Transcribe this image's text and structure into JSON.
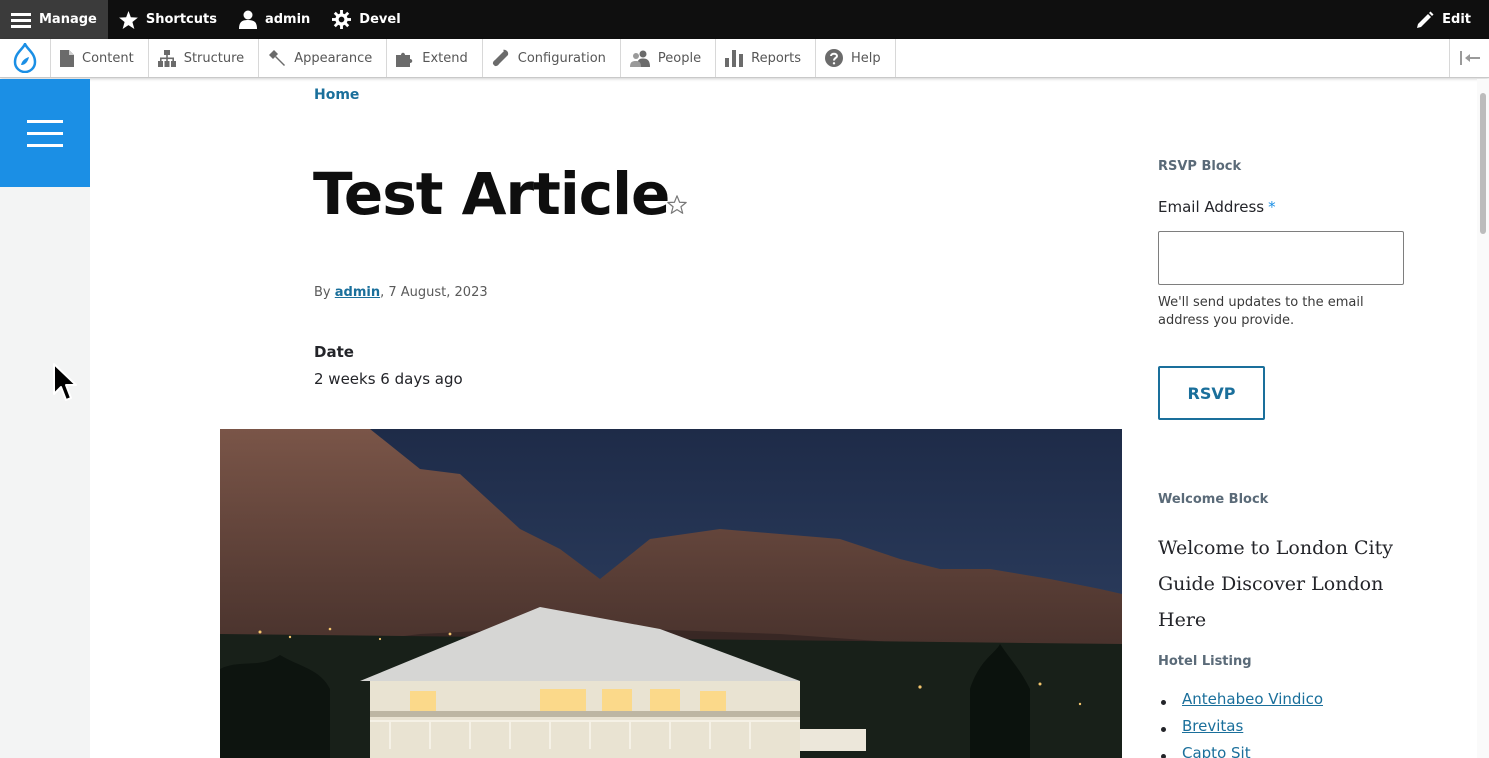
{
  "toolbar": {
    "manage": "Manage",
    "shortcuts": "Shortcuts",
    "user": "admin",
    "devel": "Devel",
    "edit": "Edit"
  },
  "tray": {
    "items": [
      {
        "label": "Content",
        "icon": "file-icon"
      },
      {
        "label": "Structure",
        "icon": "sitemap-icon"
      },
      {
        "label": "Appearance",
        "icon": "paintbrush-icon"
      },
      {
        "label": "Extend",
        "icon": "puzzle-icon"
      },
      {
        "label": "Configuration",
        "icon": "wrench-icon"
      },
      {
        "label": "People",
        "icon": "people-icon"
      },
      {
        "label": "Reports",
        "icon": "bar-chart-icon"
      },
      {
        "label": "Help",
        "icon": "help-icon"
      }
    ]
  },
  "breadcrumb": {
    "home": "Home"
  },
  "article": {
    "title": "Test Article",
    "byline_prefix": "By",
    "author": "admin",
    "byline_date": ", 7 August, 2023",
    "date_label": "Date",
    "date_value": "2 weeks 6 days ago"
  },
  "sidebar": {
    "rsvp": {
      "title": "RSVP Block",
      "email_label": "Email Address",
      "required_mark": "*",
      "email_value": "",
      "help": "We'll send updates to the email address you provide.",
      "button": "RSVP"
    },
    "welcome": {
      "title": "Welcome Block",
      "text": "Welcome to London City Guide Discover London Here"
    },
    "hotels": {
      "title": "Hotel Listing",
      "items": [
        "Antehabeo Vindico",
        "Brevitas",
        "Capto Sit"
      ]
    }
  },
  "colors": {
    "accent": "#1b8fe5",
    "link": "#1a6f9b",
    "toolbar_bg": "#0f0f0f"
  }
}
